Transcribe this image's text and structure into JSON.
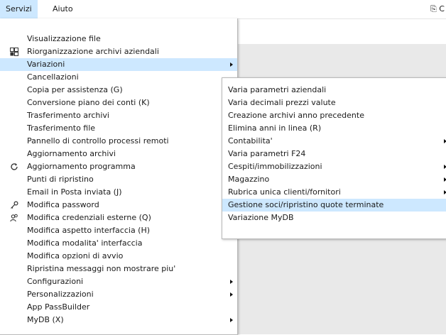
{
  "menubar": {
    "items": [
      {
        "label": "Servizi"
      },
      {
        "label": "Aiuto"
      }
    ],
    "right_text": "⎘ C"
  },
  "servizi_menu": {
    "items": [
      {
        "label": "Visualizzazione file"
      },
      {
        "label": "Riorganizzazione archivi aziendali",
        "icon": "database-icon"
      },
      {
        "label": "Variazioni",
        "submenu": true,
        "highlighted": true
      },
      {
        "label": "Cancellazioni"
      },
      {
        "label": "Copia per assistenza (G)"
      },
      {
        "label": "Conversione piano dei conti (K)"
      },
      {
        "label": "Trasferimento archivi"
      },
      {
        "label": "Trasferimento file"
      },
      {
        "label": "Pannello di controllo processi remoti"
      },
      {
        "label": "Aggiornamento archivi"
      },
      {
        "label": "Aggiornamento programma",
        "icon": "refresh-icon"
      },
      {
        "label": "Punti di ripristino"
      },
      {
        "label": "Email in Posta inviata (J)"
      },
      {
        "label": "Modifica password",
        "icon": "key-icon"
      },
      {
        "label": "Modifica credenziali esterne (Q)",
        "icon": "users-icon"
      },
      {
        "label": "Modifica aspetto interfaccia (H)"
      },
      {
        "label": "Modifica modalita' interfaccia"
      },
      {
        "label": "Modifica opzioni di avvio"
      },
      {
        "label": "Ripristina messaggi non mostrare piu'"
      },
      {
        "label": "Configurazioni",
        "submenu": true
      },
      {
        "label": "Personalizzazioni",
        "submenu": true
      },
      {
        "label": "App PassBuilder"
      },
      {
        "label": "MyDB (X)",
        "submenu": true
      }
    ]
  },
  "variazioni_submenu": {
    "items": [
      {
        "label": "Varia parametri aziendali"
      },
      {
        "label": "Varia decimali prezzi valute"
      },
      {
        "label": "Creazione archivi anno precedente"
      },
      {
        "label": "Elimina anni in linea (R)"
      },
      {
        "label": "Contabilita'",
        "submenu": true
      },
      {
        "label": "Varia parametri F24"
      },
      {
        "label": "Cespiti/immobilizzazioni",
        "submenu": true
      },
      {
        "label": "Magazzino",
        "submenu": true
      },
      {
        "label": "Rubrica unica clienti/fornitori",
        "submenu": true
      },
      {
        "label": "Gestione soci/ripristino quote terminate",
        "highlighted": true
      },
      {
        "label": "Variazione MyDB"
      }
    ]
  },
  "colors": {
    "highlight": "#cde8ff",
    "app_background": "#e9e9e9",
    "menu_border": "#b9b9b9"
  }
}
